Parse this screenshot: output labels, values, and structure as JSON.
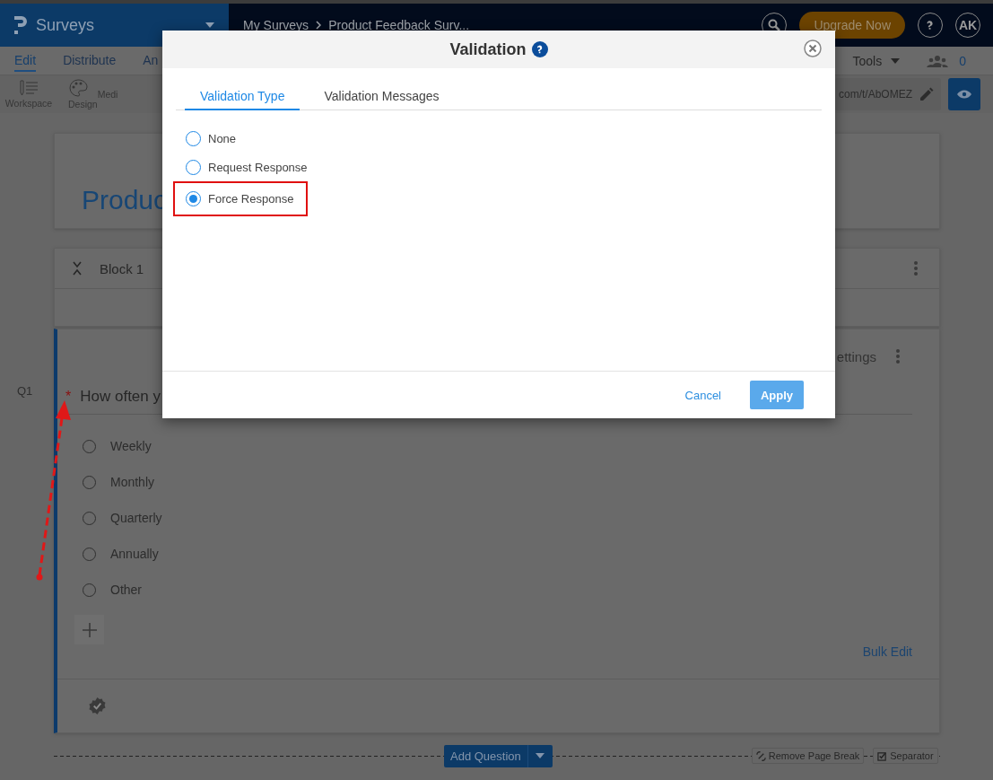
{
  "top_bar": {
    "app_name": "Surveys",
    "breadcrumb": [
      "My Surveys",
      "Product Feedback Surv..."
    ],
    "upgrade_button": "Upgrade Now",
    "avatar": "AK"
  },
  "nav_tabs": [
    {
      "label": "Edit",
      "selected": true
    },
    {
      "label": "Distribute",
      "selected": false
    },
    {
      "label": "An",
      "selected": false
    }
  ],
  "nav_right": {
    "tools": "Tools",
    "collaborators": "0"
  },
  "toolbar": [
    {
      "label": "Workspace"
    },
    {
      "label": "Design"
    },
    {
      "label": "Medi"
    }
  ],
  "survey_link": "com/t/AbOMEZ",
  "survey_title": "Produc",
  "block": {
    "title": "Block 1"
  },
  "question": {
    "number": "Q1",
    "required_mark": "*",
    "text": "How often y",
    "settings": "ettings",
    "options": [
      {
        "label": "Weekly",
        "selected": false
      },
      {
        "label": "Monthly",
        "selected": false
      },
      {
        "label": "Quarterly",
        "selected": false
      },
      {
        "label": "Annually",
        "selected": false
      },
      {
        "label": "Other",
        "selected": false
      }
    ],
    "bulk_edit": "Bulk Edit"
  },
  "page_actions": {
    "add_question": "Add Question",
    "remove_page_break": "Remove Page Break",
    "separator": "Separator"
  },
  "dialog": {
    "title": "Validation",
    "tabs": [
      {
        "label": "Validation Type",
        "selected": true
      },
      {
        "label": "Validation Messages",
        "selected": false
      }
    ],
    "options": [
      {
        "label": "None",
        "selected": false,
        "highlighted": false
      },
      {
        "label": "Request Response",
        "selected": false,
        "highlighted": false
      },
      {
        "label": "Force Response",
        "selected": true,
        "highlighted": true
      }
    ],
    "cancel": "Cancel",
    "apply": "Apply"
  }
}
